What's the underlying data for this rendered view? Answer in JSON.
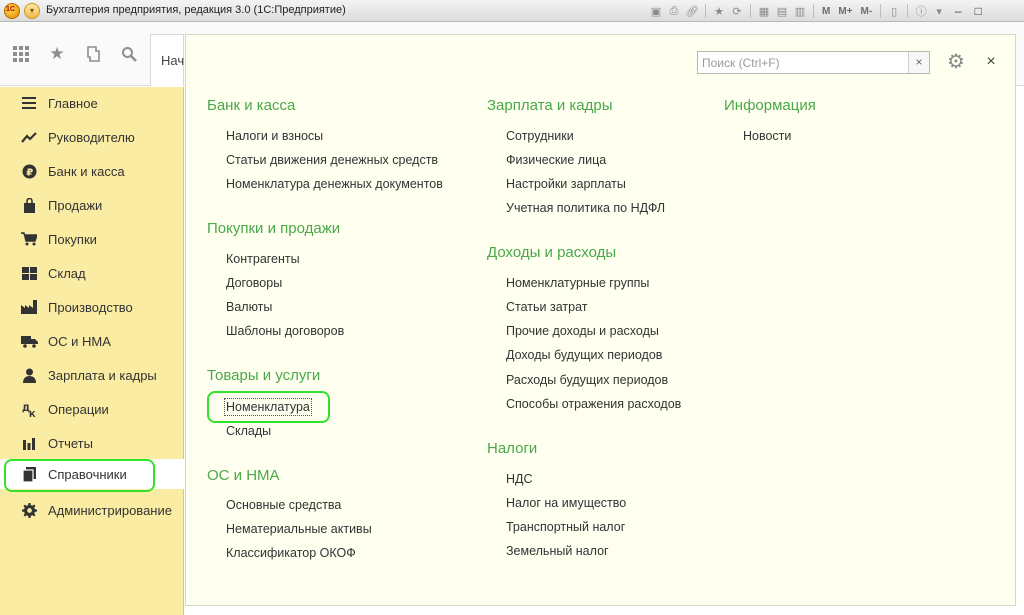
{
  "window": {
    "title": "Бухгалтерия предприятия, редакция 3.0  (1С:Предприятие)",
    "toolbar_text": [
      "M",
      "M+",
      "M-"
    ]
  },
  "nav": {
    "start_tab_label": "Нач"
  },
  "sidebar": {
    "items": [
      {
        "label": "Главное",
        "icon": "menu-lines-icon"
      },
      {
        "label": "Руководителю",
        "icon": "trend-icon"
      },
      {
        "label": "Банк и касса",
        "icon": "ruble-icon"
      },
      {
        "label": "Продажи",
        "icon": "bag-icon"
      },
      {
        "label": "Покупки",
        "icon": "cart-icon"
      },
      {
        "label": "Склад",
        "icon": "warehouse-icon"
      },
      {
        "label": "Производство",
        "icon": "factory-icon"
      },
      {
        "label": "ОС и НМА",
        "icon": "truck-icon"
      },
      {
        "label": "Зарплата и кадры",
        "icon": "person-icon"
      },
      {
        "label": "Операции",
        "icon": "operations-icon"
      },
      {
        "label": "Отчеты",
        "icon": "bar-chart-icon"
      },
      {
        "label": "Справочники",
        "icon": "books-icon"
      },
      {
        "label": "Администрирование",
        "icon": "gear-icon"
      }
    ],
    "active_index": 11
  },
  "panel": {
    "search_placeholder": "Поиск (Ctrl+F)",
    "columns": [
      {
        "sections": [
          {
            "title": "Банк и касса",
            "links": [
              "Налоги и взносы",
              "Статьи движения денежных средств",
              "Номенклатура денежных документов"
            ]
          },
          {
            "title": "Покупки и продажи",
            "links": [
              "Контрагенты",
              "Договоры",
              "Валюты",
              "Шаблоны договоров"
            ]
          },
          {
            "title": "Товары и услуги",
            "links": [
              "Номенклатура",
              "Склады"
            ]
          },
          {
            "title": "ОС и НМА",
            "links": [
              "Основные средства",
              "Нематериальные активы",
              "Классификатор ОКОФ"
            ]
          }
        ]
      },
      {
        "sections": [
          {
            "title": "Зарплата и кадры",
            "links": [
              "Сотрудники",
              "Физические лица",
              "Настройки зарплаты",
              "Учетная политика по НДФЛ"
            ]
          },
          {
            "title": "Доходы и расходы",
            "links": [
              "Номенклатурные группы",
              "Статьи затрат",
              "Прочие доходы и расходы",
              "Доходы будущих периодов",
              "Расходы будущих периодов",
              "Способы отражения расходов"
            ]
          },
          {
            "title": "Налоги",
            "links": [
              "НДС",
              "Налог на имущество",
              "Транспортный налог",
              "Земельный налог"
            ]
          }
        ]
      },
      {
        "sections": [
          {
            "title": "Информация",
            "links": [
              "Новости"
            ]
          }
        ]
      }
    ]
  },
  "colors": {
    "sidebar_bg": "#fbeca4",
    "section_heading": "#4aa84a",
    "highlight": "#33e22b",
    "panel_bg": "#fffff0"
  }
}
